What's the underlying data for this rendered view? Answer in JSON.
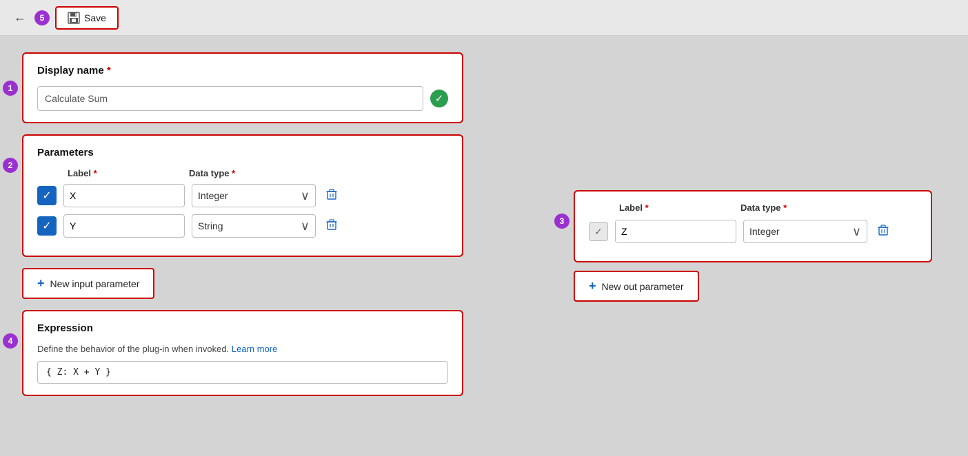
{
  "toolbar": {
    "back_label": "←",
    "step_number": "5",
    "save_label": "Save"
  },
  "display_name_section": {
    "step_number": "1",
    "title": "Display name",
    "required": "*",
    "input_value": "Calculate Sum",
    "input_placeholder": "Calculate Sum"
  },
  "parameters_section": {
    "step_number": "2",
    "title": "Parameters",
    "label_header": "Label",
    "required": "*",
    "data_type_header": "Data type",
    "rows": [
      {
        "checked": true,
        "label": "X",
        "data_type": "Integer"
      },
      {
        "checked": true,
        "label": "Y",
        "data_type": "String"
      }
    ],
    "new_param_button": "New input parameter"
  },
  "expression_section": {
    "step_number": "4",
    "title": "Expression",
    "description": "Define the behavior of the plug-in when invoked.",
    "learn_more_label": "Learn more",
    "code": "{ Z: X + Y }"
  },
  "out_parameters_section": {
    "step_number": "3",
    "label_header": "Label",
    "required": "*",
    "data_type_header": "Data type",
    "rows": [
      {
        "checked": false,
        "label": "Z",
        "data_type": "Integer"
      }
    ],
    "new_param_button": "New out parameter"
  },
  "icons": {
    "back": "←",
    "save_floppy": "💾",
    "check": "✓",
    "chevron": "∨",
    "delete": "🗑",
    "plus": "+"
  },
  "colors": {
    "red_border": "#c00",
    "purple_badge": "#9b30d0",
    "blue_checkbox": "#1565c0",
    "green_check": "#2a9d4e"
  }
}
